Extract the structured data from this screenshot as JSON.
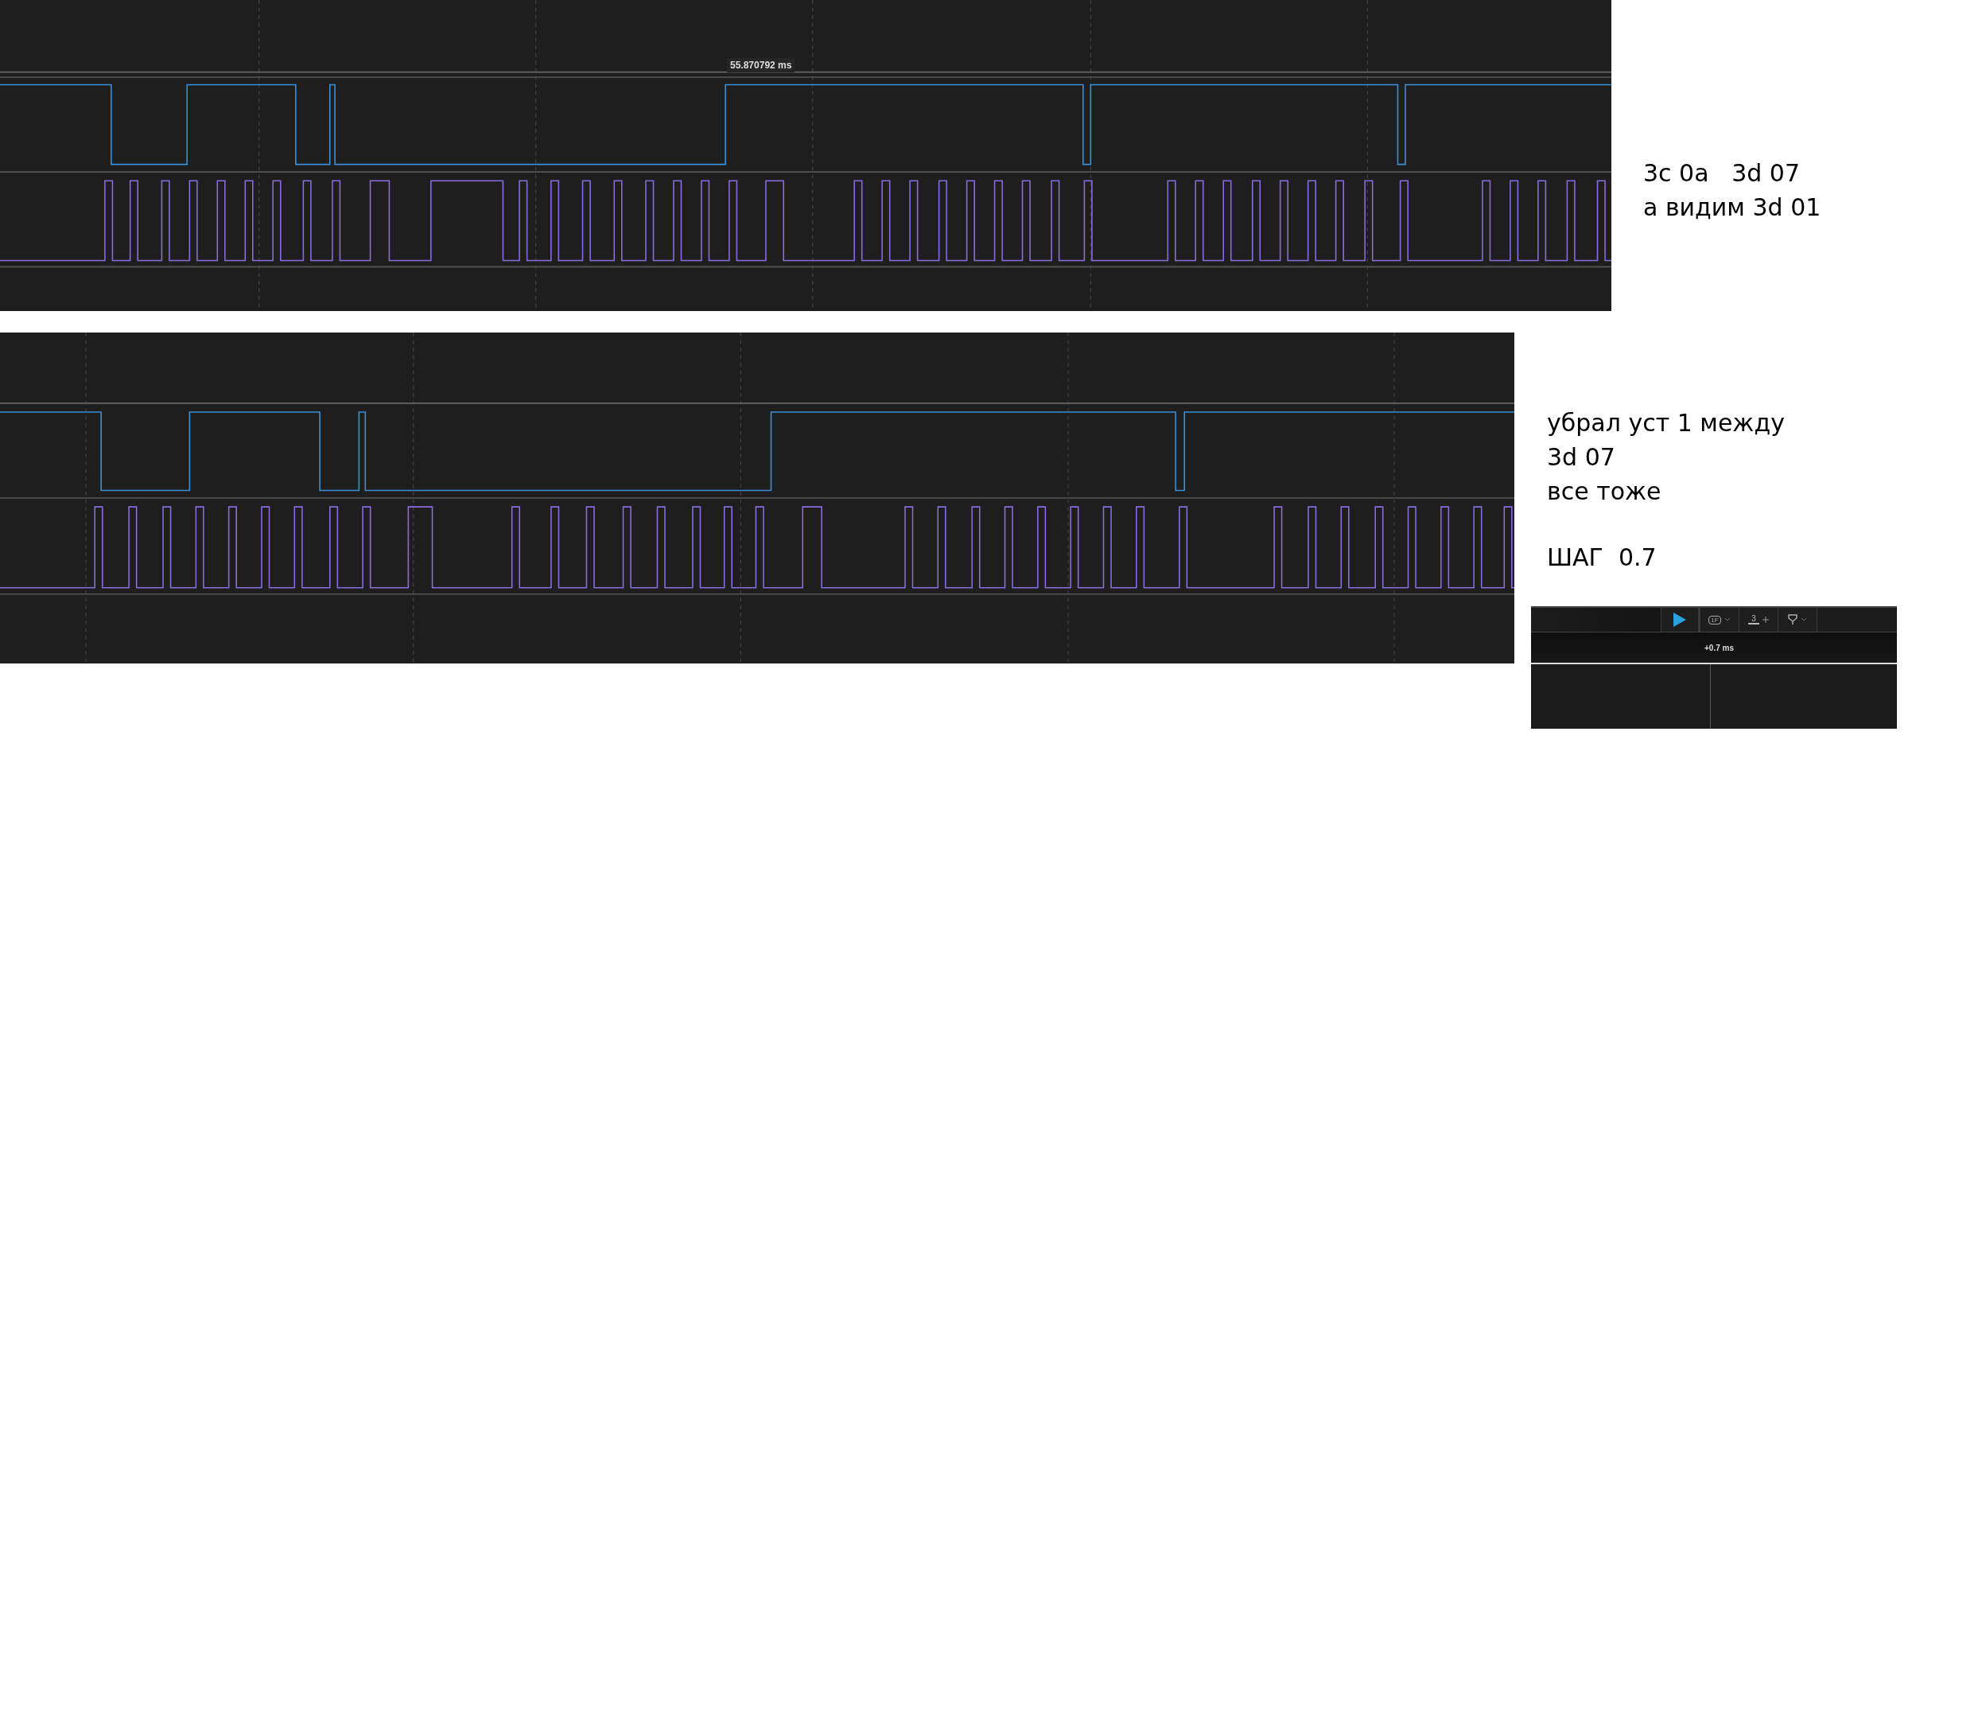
{
  "top_capture": {
    "time_label": "55.870792 ms"
  },
  "top_note": [
    "3c 0a   3d 07",
    "а видим 3d 01"
  ],
  "bottom_note": [
    "убрал уст 1 между",
    "3d 07",
    "все тоже"
  ],
  "step_note": "ШАГ  0.7",
  "toolbar": {
    "trigger_label": "1F",
    "measure_count": "3",
    "time_offset": "+0.7 ms"
  }
}
